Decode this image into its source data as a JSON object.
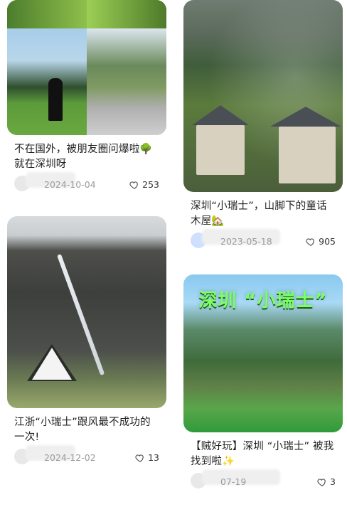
{
  "feed": {
    "cards": [
      {
        "title": "不在国外，被朋友圈问爆啦🌳就在深圳呀",
        "date": "2024-10-04",
        "likes": "253"
      },
      {
        "title": "深圳“小瑞士”，山脚下的童话木屋🏡",
        "date": "2023-05-18",
        "likes": "905"
      },
      {
        "title": "江浙“小瑞士”跟风最不成功的一次!",
        "date": "2024-12-02",
        "likes": "13"
      },
      {
        "title": "【贼好玩】深圳 “小瑞士” 被我找到啦✨",
        "date": "07-19",
        "likes": "3",
        "overlay": "深圳 “小瑞士”"
      }
    ]
  }
}
